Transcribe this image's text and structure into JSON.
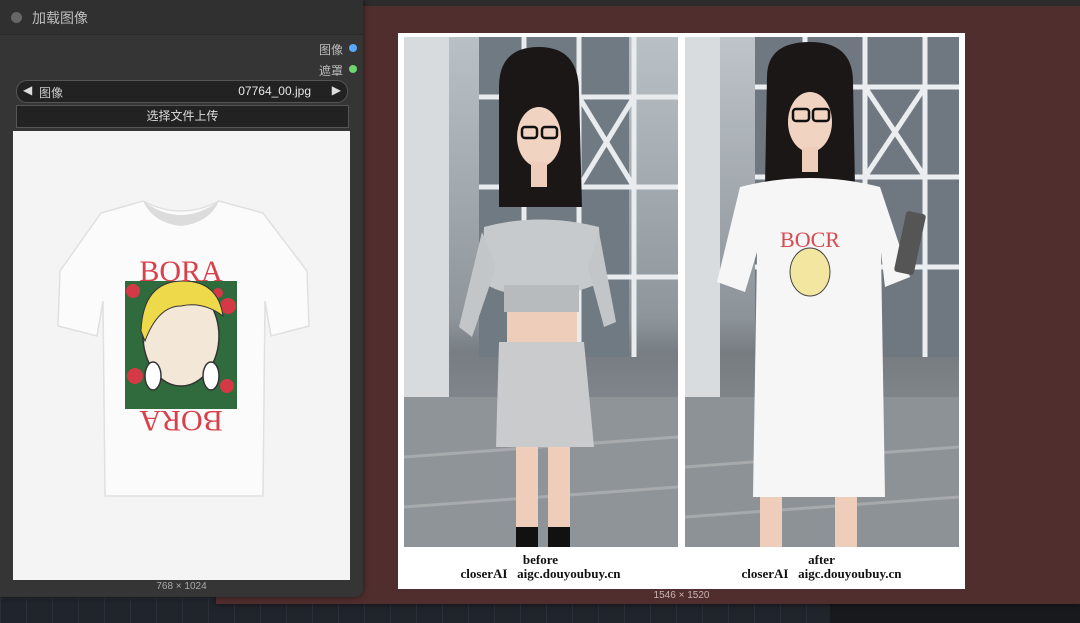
{
  "load_node": {
    "title": "加载图像",
    "outputs": [
      {
        "label": "图像",
        "color": "#5aa8ff"
      },
      {
        "label": "遮罩",
        "color": "#6fd36f"
      }
    ],
    "image_widget": {
      "label": "图像",
      "value": "07764_00.jpg"
    },
    "upload_label": "选择文件上传",
    "preview_dims": "768 × 1024",
    "shirt_text_top": "BORA",
    "shirt_text_bottom": "BORA"
  },
  "result_node": {
    "before_caption": "before",
    "after_caption": "after",
    "credit_left": "closerAI   aigc.douyoubuy.cn",
    "credit_right": "closerAI   aigc.douyoubuy.cn",
    "dims": "1546 × 1520",
    "accent_bg": "#512e2e"
  }
}
